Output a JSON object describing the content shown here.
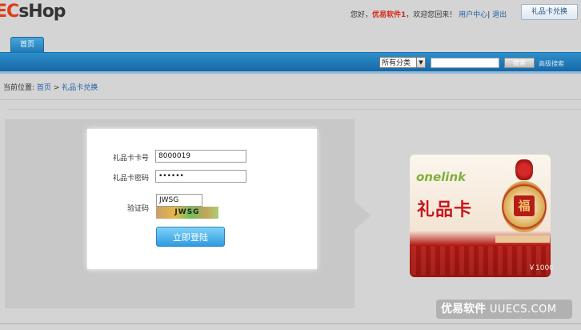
{
  "header": {
    "logo_prefix": "EC",
    "logo_rest": "sHop",
    "greeting": "您好，",
    "username": "优易软件1",
    "welcome": "，欢迎您回来！",
    "user_center": "用户中心",
    "separator": "|",
    "logout": "退出",
    "gift_card_button": "礼品卡兑换"
  },
  "nav": {
    "home_tab": "首页",
    "category_select": "所有分类",
    "category_arrow": "▼",
    "search_value": "",
    "search_button": "搜索",
    "advanced_search": "高级搜索"
  },
  "breadcrumb": {
    "prefix": "当前位置:",
    "home": "首页",
    "arrow": ">",
    "current": "礼品卡兑换"
  },
  "form": {
    "card_number_label": "礼品卡卡号",
    "card_number_value": "8000019",
    "card_password_label": "礼品卡密码",
    "card_password_value": "••••••",
    "captcha_label": "验证码",
    "captcha_value": "JWSG",
    "captcha_image_text": "JWSG",
    "login_button": "立即登陆"
  },
  "gift_card": {
    "brand": "onelink",
    "title": "礼品卡",
    "value": "￥1000",
    "medal_char": "福"
  },
  "watermark": {
    "text": "优易软件",
    "domain": "UUECS.COM"
  }
}
